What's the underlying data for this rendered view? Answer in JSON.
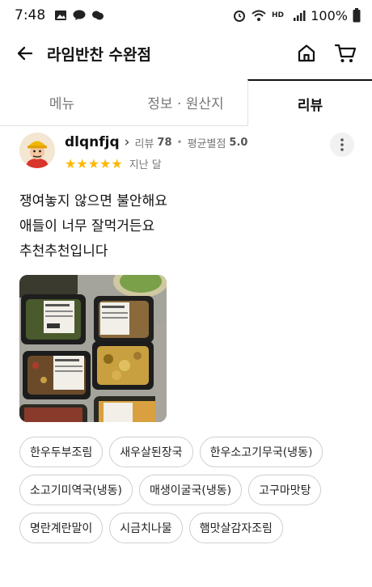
{
  "status_bar": {
    "time": "7:48",
    "battery": "100%"
  },
  "header": {
    "title": "라임반찬 수완점"
  },
  "tabs": [
    {
      "label": "메뉴"
    },
    {
      "label": "정보 · 원산지"
    },
    {
      "label": "리뷰"
    }
  ],
  "review": {
    "username": "dlqnfjq",
    "review_count_label": "리뷰",
    "review_count": "78",
    "avg_label": "평균별점",
    "avg_rating": "5.0",
    "stars": "★★★★★",
    "rating": 5,
    "date": "지난 달",
    "lines": [
      "쟁여놓지 않으면 불안해요",
      "애들이 너무 잘먹거든요",
      "추천추천입니다"
    ],
    "tags": [
      "한우두부조림",
      "새우살된장국",
      "한우소고기무국(냉동)",
      "소고기미역국(냉동)",
      "매생이굴국(냉동)",
      "고구마맛탕",
      "명란계란말이",
      "시금치나물",
      "햄맛살감자조림"
    ]
  },
  "colors": {
    "star": "#ffb800",
    "text": "#111111",
    "muted": "#777777"
  }
}
